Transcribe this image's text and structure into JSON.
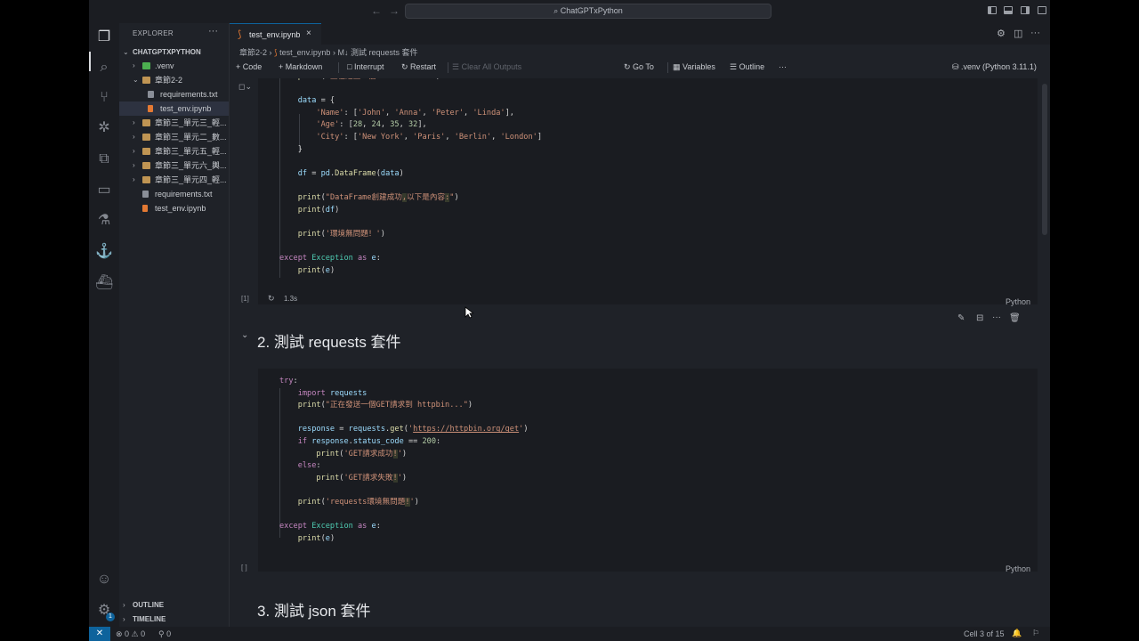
{
  "titlebar": {
    "search": "ChatGPTxPython"
  },
  "sidebar": {
    "title": "EXPLORER",
    "project": "CHATGPTXPYTHON",
    "items": [
      {
        "label": ".venv"
      },
      {
        "label": "章節2-2"
      },
      {
        "label": "requirements.txt"
      },
      {
        "label": "test_env.ipynb"
      },
      {
        "label": "章節三_單元三_輕..."
      },
      {
        "label": "章節三_單元二_數..."
      },
      {
        "label": "章節三_單元五_輕..."
      },
      {
        "label": "章節三_單元六_輿..."
      },
      {
        "label": "章節三_單元四_輕..."
      },
      {
        "label": "requirements.txt"
      },
      {
        "label": "test_env.ipynb"
      }
    ],
    "outline": "OUTLINE",
    "timeline": "TIMELINE"
  },
  "tab": {
    "label": "test_env.ipynb",
    "close": "×"
  },
  "breadcrumb": {
    "folder": "章節2-2",
    "file": "test_env.ipynb",
    "section": "M↓ 測試 requests 套件"
  },
  "toolbar": {
    "code": "+ Code",
    "markdown": "+ Markdown",
    "interrupt": "Interrupt",
    "restart": "Restart",
    "clear": "Clear All Outputs",
    "goto": "Go To",
    "variables": "Variables",
    "outline": "Outline",
    "more": "···",
    "kernel": ".venv (Python 3.11.1)"
  },
  "cell1": {
    "exec_count": "[1]",
    "time": "1.3s",
    "lang": "Python"
  },
  "heading2": "2. 測試 requests 套件",
  "cell2": {
    "exec_count": "[ ]",
    "lang": "Python"
  },
  "heading3": "3. 測試 json 套件",
  "statusbar": {
    "problems": "⊗ 0 ⚠ 0",
    "ports": "⚲ 0",
    "cell": "Cell 3 of 15"
  },
  "colors": {
    "accent": "#0e639c",
    "bg": "#1f2228",
    "cell_bg": "#1a1c21"
  }
}
